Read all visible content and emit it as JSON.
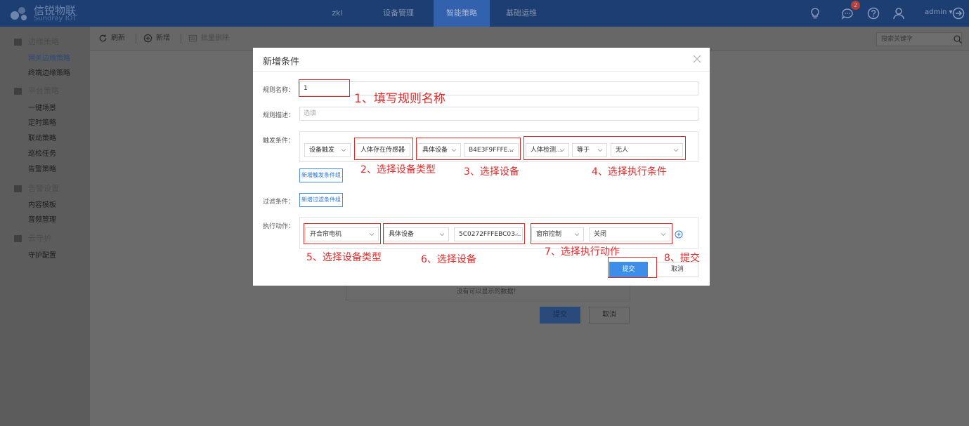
{
  "app": {
    "brand_title": "信锐物联",
    "brand_subtitle": "Sundray IOT"
  },
  "topnav": {
    "items": [
      {
        "label": "zkl"
      },
      {
        "label": "设备管理"
      },
      {
        "label": "智能策略",
        "active": true
      },
      {
        "label": "基础运维"
      }
    ],
    "notification_count": "2",
    "user": "admin ▾"
  },
  "sidebar": {
    "groups": [
      {
        "label": "边缘策略",
        "icon": "folder-icon",
        "items": [
          "网关边缘策略",
          "终端边缘策略"
        ]
      },
      {
        "label": "平台策略",
        "icon": "chart-icon",
        "items": [
          "一键场景",
          "定时策略",
          "联动策略",
          "巡检任务",
          "告警策略"
        ]
      },
      {
        "label": "告警设置",
        "icon": "alarm-icon",
        "items": [
          "内容模板",
          "音频管理"
        ]
      },
      {
        "label": "云守护",
        "icon": "shield-icon",
        "items": [
          "守护配置"
        ]
      }
    ]
  },
  "toolbar": {
    "refresh": "刷新",
    "add": "新增",
    "batch_delete": "批量删除",
    "search_placeholder": "搜索关键字"
  },
  "background_dialog": {
    "empty_text": "没有可以显示的数据！",
    "submit": "提交",
    "cancel": "取消"
  },
  "modal": {
    "title": "新增条件",
    "rule_name_label": "规则名称：",
    "rule_name_value": "1",
    "rule_desc_label": "规则描述：",
    "rule_desc_placeholder": "选填",
    "trigger_label": "触发条件：",
    "trigger": {
      "trigger_type": "设备触发",
      "device_type": "人体存在传感器",
      "device_scope": "具体设备",
      "device_id": "B4E3F9FFFE...",
      "condition": "人体检测...",
      "operator": "等于",
      "value": "无人"
    },
    "add_trigger_group": "新增触发条件组",
    "filter_label": "过滤条件：",
    "add_filter_group": "新增过滤条件组",
    "action_label": "执行动作：",
    "action": {
      "device_type": "开合帘电机",
      "device_scope": "具体设备",
      "device_id": "5C0272FFFEBC03...",
      "action_type": "窗帘控制",
      "action_value": "关闭"
    },
    "submit": "提交",
    "cancel": "取消"
  },
  "annotations": {
    "step1": "1、填写规则名称",
    "step2": "2、选择设备类型",
    "step3": "3、选择设备",
    "step4": "4、选择执行条件",
    "step5": "5、选择设备类型",
    "step6": "6、选择设备",
    "step7": "7、选择执行动作",
    "step8": "8、提交",
    "color": "#e02b2b"
  }
}
